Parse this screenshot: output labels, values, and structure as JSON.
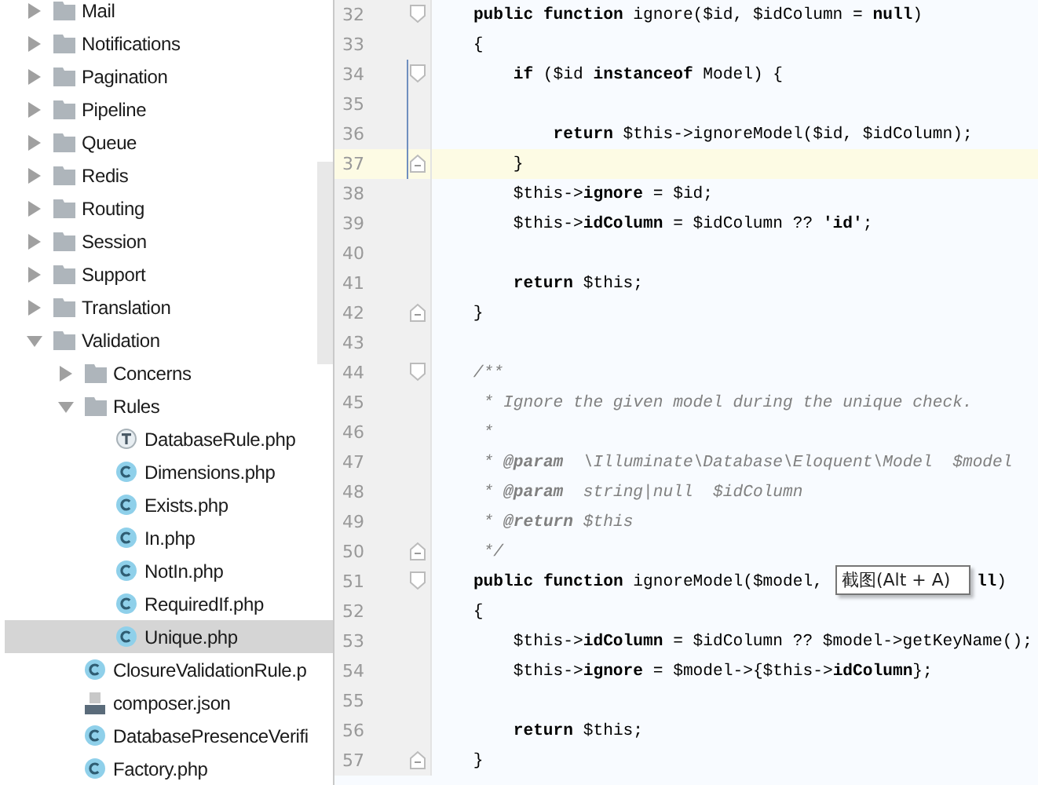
{
  "project_tree": {
    "items": [
      {
        "name": "Mail",
        "kind": "folder",
        "expanded": false,
        "selected": false
      },
      {
        "name": "Notifications",
        "kind": "folder",
        "expanded": false,
        "selected": false
      },
      {
        "name": "Pagination",
        "kind": "folder",
        "expanded": false,
        "selected": false
      },
      {
        "name": "Pipeline",
        "kind": "folder",
        "expanded": false,
        "selected": false
      },
      {
        "name": "Queue",
        "kind": "folder",
        "expanded": false,
        "selected": false
      },
      {
        "name": "Redis",
        "kind": "folder",
        "expanded": false,
        "selected": false
      },
      {
        "name": "Routing",
        "kind": "folder",
        "expanded": false,
        "selected": false
      },
      {
        "name": "Session",
        "kind": "folder",
        "expanded": false,
        "selected": false
      },
      {
        "name": "Support",
        "kind": "folder",
        "expanded": false,
        "selected": false
      },
      {
        "name": "Translation",
        "kind": "folder",
        "expanded": false,
        "selected": false
      },
      {
        "name": "Validation",
        "kind": "folder",
        "expanded": true,
        "selected": false,
        "children": [
          {
            "name": "Concerns",
            "kind": "folder",
            "expanded": false,
            "selected": false
          },
          {
            "name": "Rules",
            "kind": "folder",
            "expanded": true,
            "selected": false,
            "children": [
              {
                "name": "DatabaseRule.php",
                "kind": "trait",
                "selected": false
              },
              {
                "name": "Dimensions.php",
                "kind": "class",
                "selected": false
              },
              {
                "name": "Exists.php",
                "kind": "class",
                "selected": false
              },
              {
                "name": "In.php",
                "kind": "class",
                "selected": false
              },
              {
                "name": "NotIn.php",
                "kind": "class",
                "selected": false
              },
              {
                "name": "RequiredIf.php",
                "kind": "class",
                "selected": false
              },
              {
                "name": "Unique.php",
                "kind": "class",
                "selected": true
              }
            ]
          },
          {
            "name": "ClosureValidationRule.p",
            "kind": "class",
            "selected": false
          },
          {
            "name": "composer.json",
            "kind": "json",
            "selected": false
          },
          {
            "name": "DatabasePresenceVerifi",
            "kind": "class",
            "selected": false
          },
          {
            "name": "Factory.php",
            "kind": "class",
            "selected": false
          }
        ]
      }
    ]
  },
  "editor": {
    "lines": [
      {
        "number": "32",
        "fold_start": true,
        "fold_end": false,
        "current": false,
        "modified": false,
        "kind": "code",
        "code": "    **public function** ignore($id, $idColumn = **null**)"
      },
      {
        "number": "33",
        "fold_start": false,
        "fold_end": false,
        "current": false,
        "modified": false,
        "kind": "code",
        "code": "    {"
      },
      {
        "number": "34",
        "fold_start": true,
        "fold_end": false,
        "current": false,
        "modified": true,
        "kind": "code",
        "code": "        **if** ($id **instanceof** Model) {"
      },
      {
        "number": "35",
        "fold_start": false,
        "fold_end": false,
        "current": false,
        "modified": true
      },
      {
        "number": "36",
        "fold_start": false,
        "fold_end": false,
        "current": false,
        "modified": true,
        "kind": "code",
        "code": "            **return** $this->ignoreModel($id, $idColumn);"
      },
      {
        "number": "37",
        "fold_start": false,
        "fold_end": true,
        "current": true,
        "modified": true,
        "kind": "code",
        "code": "        }"
      },
      {
        "number": "38",
        "fold_start": false,
        "fold_end": false,
        "current": false,
        "modified": false,
        "kind": "code",
        "code": "        $this->**ignore** = $id;"
      },
      {
        "number": "39",
        "fold_start": false,
        "fold_end": false,
        "current": false,
        "modified": false,
        "kind": "code",
        "code": "        $this->**idColumn** = $idColumn ?? **'id'**;"
      },
      {
        "number": "40",
        "fold_start": false,
        "fold_end": false,
        "current": false,
        "modified": false
      },
      {
        "number": "41",
        "fold_start": false,
        "fold_end": false,
        "current": false,
        "modified": false,
        "kind": "code",
        "code": "        **return** $this;"
      },
      {
        "number": "42",
        "fold_start": false,
        "fold_end": true,
        "current": false,
        "modified": false,
        "kind": "code",
        "code": "    }"
      },
      {
        "number": "43",
        "fold_start": false,
        "fold_end": false,
        "current": false,
        "modified": false
      },
      {
        "number": "44",
        "fold_start": true,
        "fold_end": false,
        "current": false,
        "modified": false,
        "kind": "comment",
        "code": "    /**"
      },
      {
        "number": "45",
        "fold_start": false,
        "fold_end": false,
        "current": false,
        "modified": false,
        "kind": "comment",
        "code": "     * Ignore the given model during the unique check."
      },
      {
        "number": "46",
        "fold_start": false,
        "fold_end": false,
        "current": false,
        "modified": false,
        "kind": "comment",
        "code": "     *"
      },
      {
        "number": "47",
        "fold_start": false,
        "fold_end": false,
        "current": false,
        "modified": false,
        "kind": "comment",
        "code": "     * **@param**  \\Illuminate\\Database\\Eloquent\\Model  $model"
      },
      {
        "number": "48",
        "fold_start": false,
        "fold_end": false,
        "current": false,
        "modified": false,
        "kind": "comment",
        "code": "     * **@param**  string|null  $idColumn"
      },
      {
        "number": "49",
        "fold_start": false,
        "fold_end": false,
        "current": false,
        "modified": false,
        "kind": "comment",
        "code": "     * **@return** $this"
      },
      {
        "number": "50",
        "fold_start": false,
        "fold_end": true,
        "current": false,
        "modified": false,
        "kind": "comment",
        "code": "     */"
      },
      {
        "number": "51",
        "fold_start": true,
        "fold_end": false,
        "current": false,
        "modified": false,
        "kind": "code",
        "code": "    **public function** ignoreModel($model,",
        "tooltip": "截图(Alt + A)",
        "code_after": "**ll**)"
      },
      {
        "number": "52",
        "fold_start": false,
        "fold_end": false,
        "current": false,
        "modified": false,
        "kind": "code",
        "code": "    {"
      },
      {
        "number": "53",
        "fold_start": false,
        "fold_end": false,
        "current": false,
        "modified": false,
        "kind": "code",
        "code": "        $this->**idColumn** = $idColumn ?? $model->getKeyName();"
      },
      {
        "number": "54",
        "fold_start": false,
        "fold_end": false,
        "current": false,
        "modified": false,
        "kind": "code",
        "code": "        $this->**ignore** = $model->{$this->**idColumn**};"
      },
      {
        "number": "55",
        "fold_start": false,
        "fold_end": false,
        "current": false,
        "modified": false
      },
      {
        "number": "56",
        "fold_start": false,
        "fold_end": false,
        "current": false,
        "modified": false,
        "kind": "code",
        "code": "        **return** $this;"
      },
      {
        "number": "57",
        "fold_start": false,
        "fold_end": true,
        "current": false,
        "modified": false,
        "kind": "code",
        "code": "    }"
      }
    ]
  }
}
